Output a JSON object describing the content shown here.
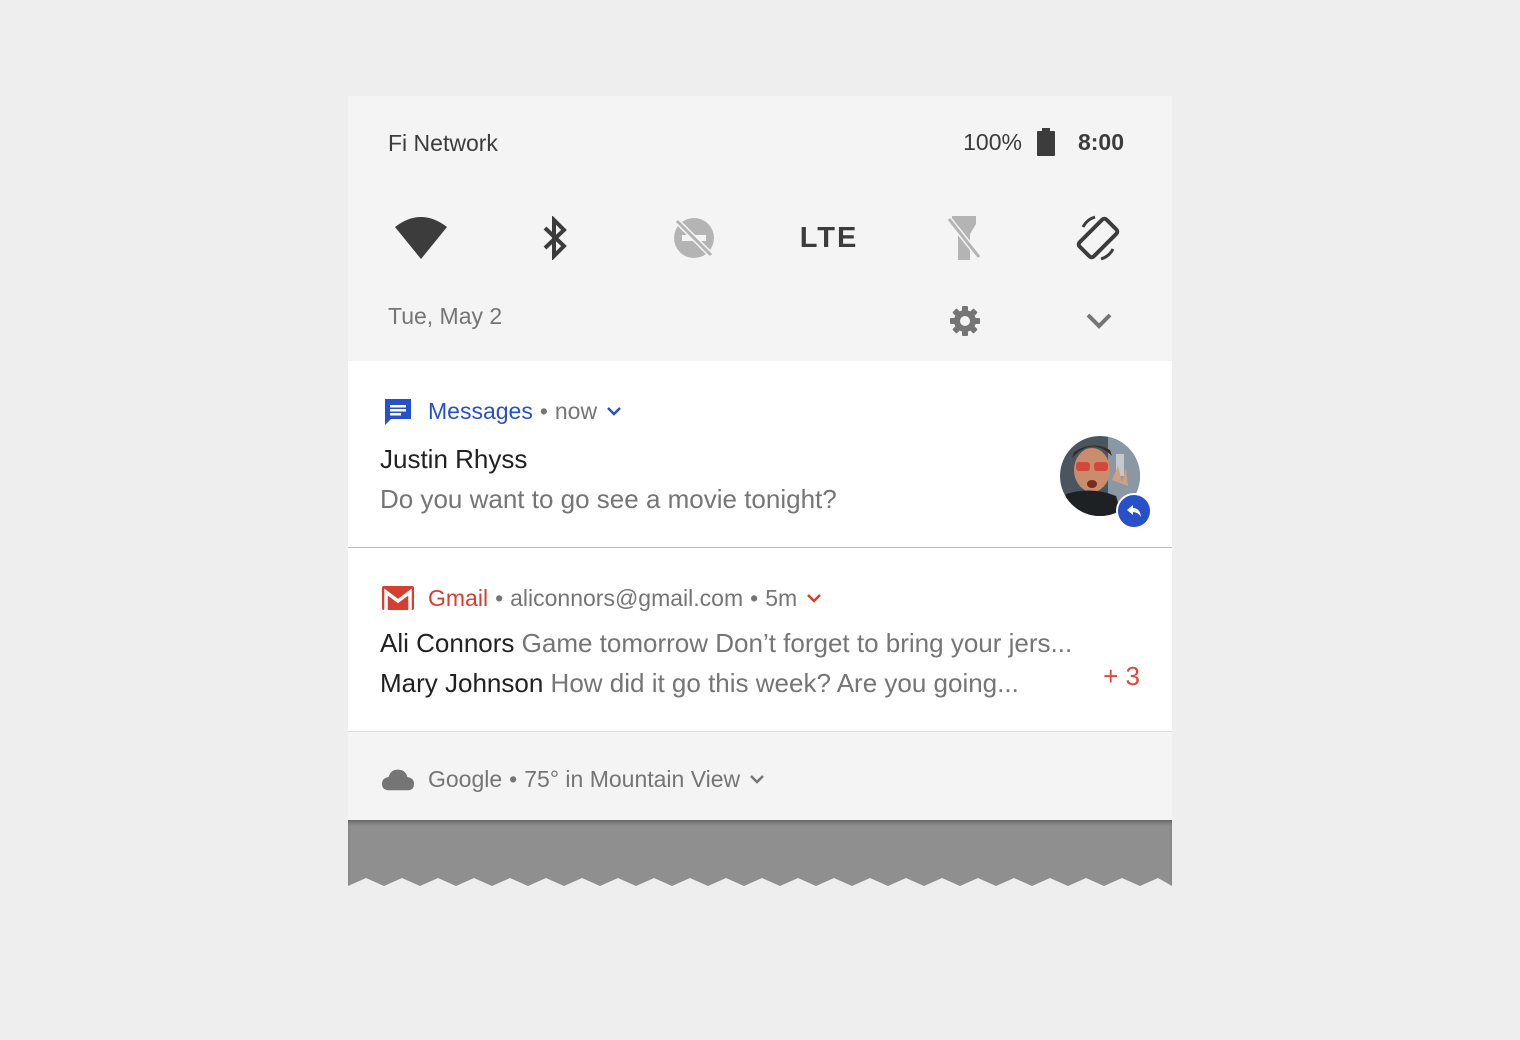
{
  "status_bar": {
    "carrier": "Fi Network",
    "battery_percent": "100%",
    "time": "8:00"
  },
  "quick_settings": {
    "tiles": [
      {
        "name": "wifi-icon",
        "state": "on"
      },
      {
        "name": "bluetooth-icon",
        "state": "on"
      },
      {
        "name": "do-not-disturb-off-icon",
        "state": "off"
      },
      {
        "name": "lte-label",
        "label": "LTE",
        "state": "on"
      },
      {
        "name": "flashlight-off-icon",
        "state": "off"
      },
      {
        "name": "auto-rotate-icon",
        "state": "on"
      }
    ],
    "date": "Tue, May 2",
    "settings_icon": "gear-icon",
    "expand_icon": "chevron-down-icon"
  },
  "notifications": {
    "messages": {
      "app_name": "Messages",
      "separator": "•",
      "time": "now",
      "title": "Justin Rhyss",
      "text": "Do you want to go see a movie tonight?",
      "app_icon": "messages-icon",
      "avatar": "contact-avatar",
      "action_icon": "reply-icon",
      "accent_color": "#2851c9"
    },
    "gmail": {
      "app_name": "Gmail",
      "separator": "•",
      "account": "aliconnors@gmail.com",
      "separator2": "•",
      "time": "5m",
      "rows": [
        {
          "sender": "Ali Connors",
          "snippet": "Game tomorrow Don’t forget to bring your jers..."
        },
        {
          "sender": "Mary Johnson",
          "snippet": "How did it go this week? Are you going..."
        }
      ],
      "more_count": "+ 3",
      "app_icon": "gmail-icon",
      "accent_color": "#d93d2f"
    },
    "weather": {
      "app_name": "Google",
      "separator": "•",
      "summary": "75° in Mountain View",
      "app_icon": "cloud-icon"
    }
  }
}
